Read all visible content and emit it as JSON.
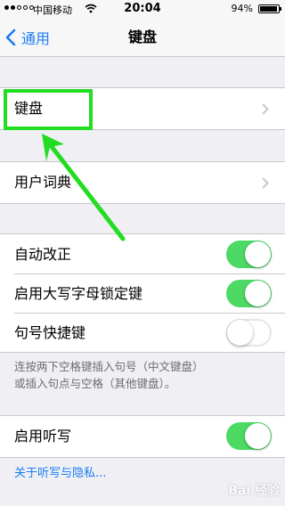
{
  "status_bar": {
    "carrier": "中国移动",
    "time": "20:04",
    "battery_percent": "94%",
    "battery_level": 0.94,
    "signal_bars_filled": 2
  },
  "nav": {
    "back_label": "通用",
    "title": "键盘"
  },
  "cells": {
    "keyboards": "键盘",
    "user_dictionary": "用户词典",
    "auto_correct": "自动改正",
    "caps_lock": "启用大写字母锁定键",
    "period_shortcut": "句号快捷键",
    "dictation": "启用听写"
  },
  "toggles": {
    "auto_correct": true,
    "caps_lock": true,
    "period_shortcut": false,
    "dictation": true
  },
  "footer_note": {
    "line1": "连按两下空格键插入句号（中文键盘）",
    "line2": "或插入句点与空格（其他键盘）。"
  },
  "links": {
    "dictation_privacy": "关于听写与隐私..."
  },
  "colors": {
    "accent": "#1a7cf5",
    "toggle_on": "#4cd964",
    "annotation": "#22dd22",
    "background": "#efeff4"
  },
  "icons": [
    "back-chevron-icon",
    "disclosure-chevron-icon",
    "wifi-icon",
    "battery-icon",
    "signal-dots-icon"
  ],
  "watermark": "Bai 经验"
}
